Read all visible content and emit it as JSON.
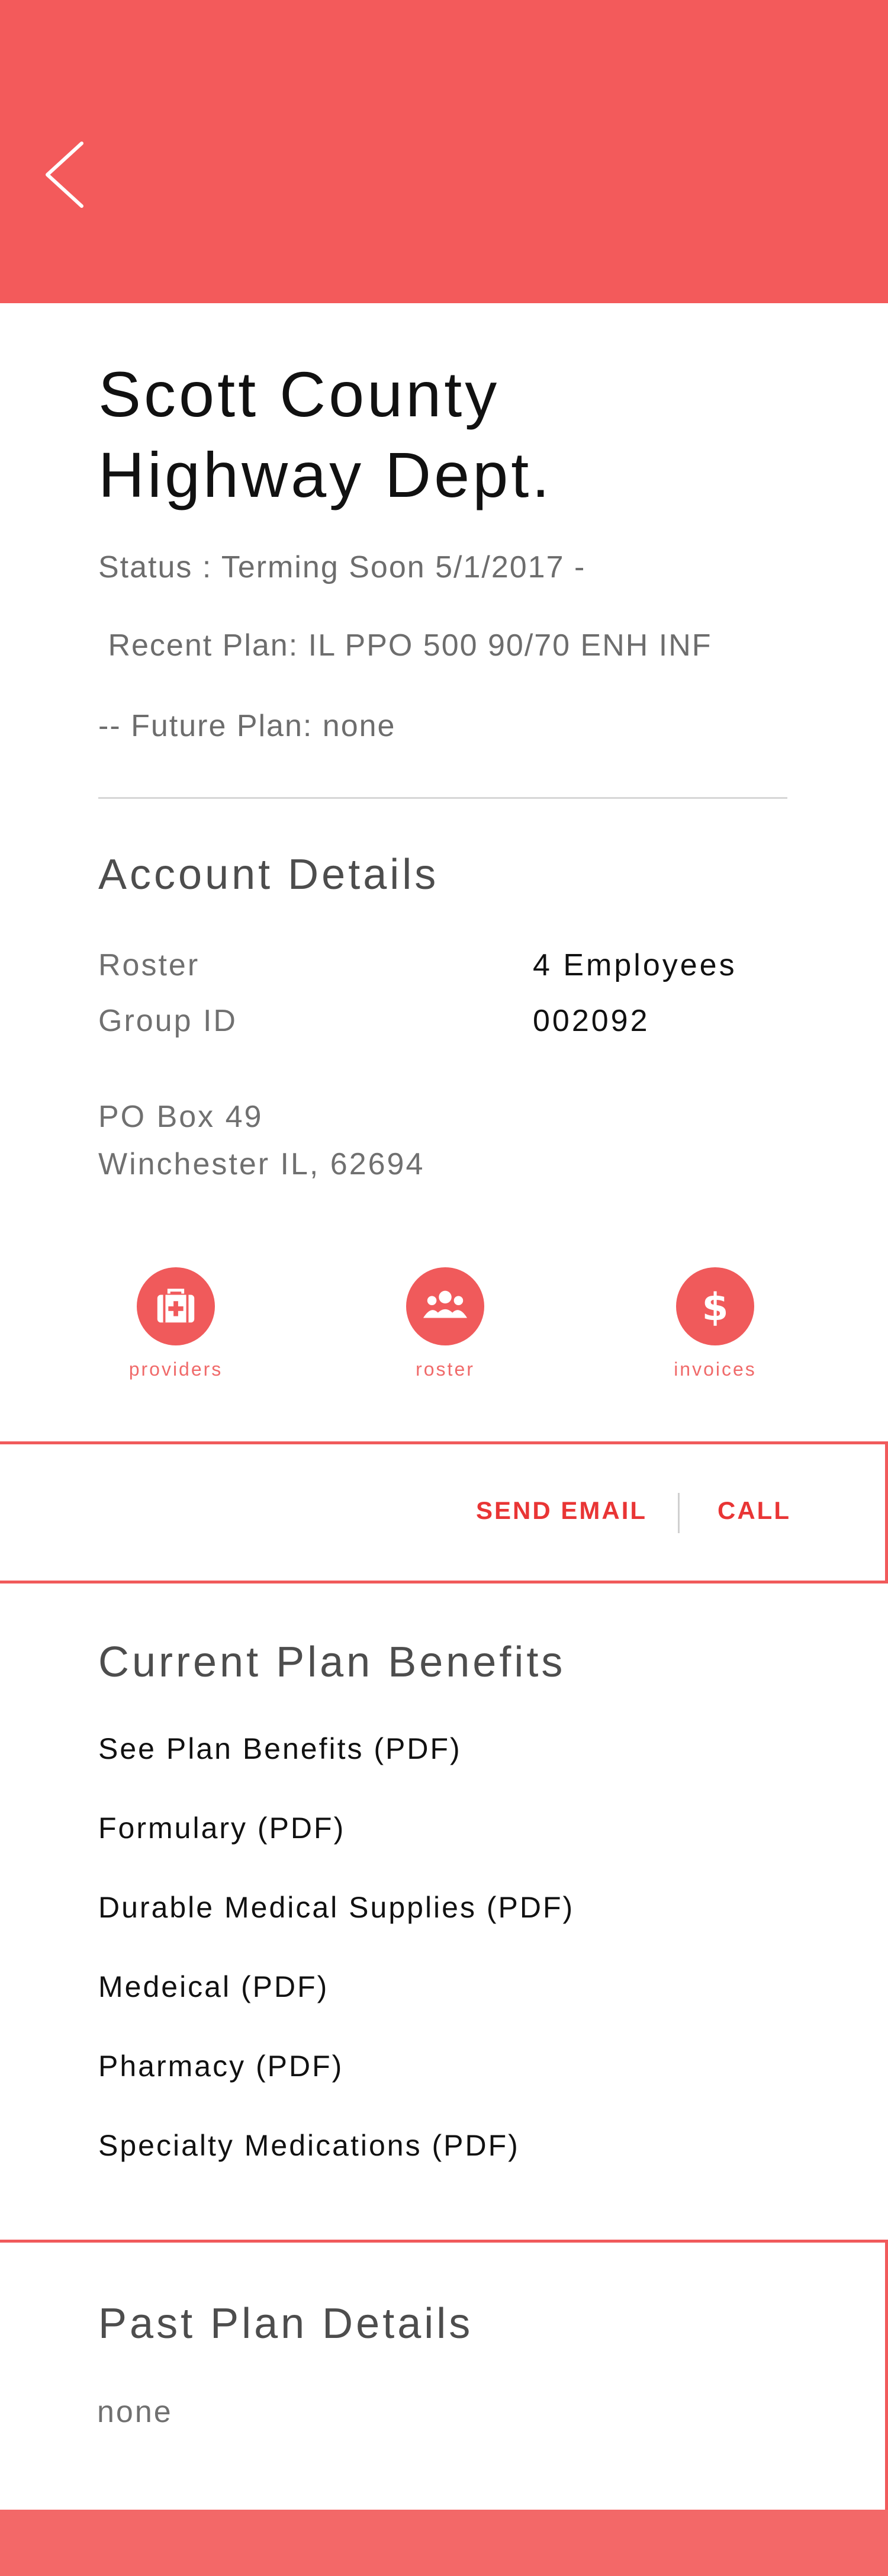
{
  "header": {
    "back_icon": "chevron-left-icon",
    "color": "#f35a5b"
  },
  "account": {
    "name_line1": "Scott County",
    "name_line2": "Highway Dept.",
    "status": "Status : Terming Soon 5/1/2017 -",
    "recent_plan": " Recent Plan: IL PPO 500 90/70 ENH INF",
    "future_plan": "-- Future Plan: none"
  },
  "account_details": {
    "title": "Account Details",
    "rows": [
      {
        "label": "Roster",
        "value": "4 Employees"
      },
      {
        "label": "Group ID",
        "value": "002092"
      }
    ],
    "address_line1": "PO Box 49",
    "address_line2": "Winchester IL, 62694"
  },
  "actions": [
    {
      "label": "providers",
      "icon": "medical-kit-icon"
    },
    {
      "label": "roster",
      "icon": "people-icon"
    },
    {
      "label": "invoices",
      "icon": "dollar-icon"
    }
  ],
  "contact": {
    "email_label": "SEND EMAIL",
    "call_label": "CALL"
  },
  "current_benefits": {
    "title": "Current Plan Benefits",
    "links": [
      "See Plan Benefits (PDF)",
      "Formulary (PDF)",
      "Durable Medical Supplies (PDF)",
      "Medeical (PDF)",
      "Pharmacy (PDF)",
      "Specialty Medications (PDF)"
    ]
  },
  "past_plan": {
    "title": "Past Plan Details",
    "value": "none"
  },
  "colors": {
    "accent": "#f35a5b",
    "link_red": "#e93535",
    "footer": "#f36868"
  }
}
